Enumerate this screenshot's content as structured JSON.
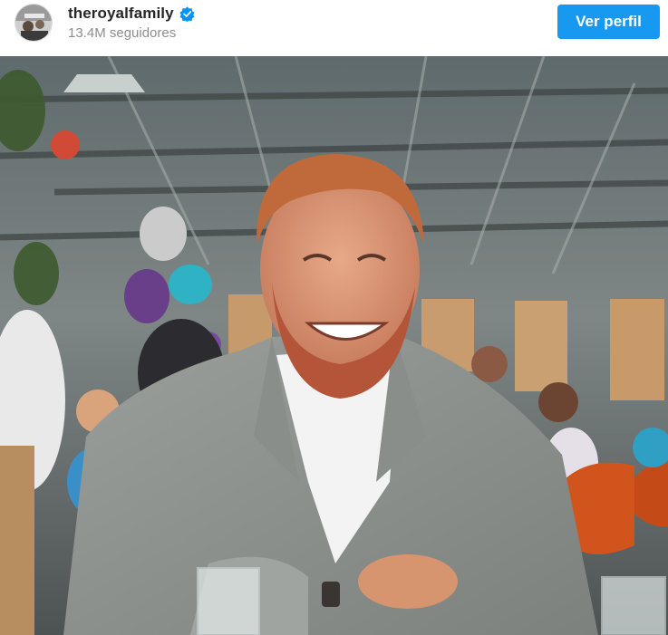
{
  "header": {
    "username": "theroyalfamily",
    "followers": "13.4M seguidores",
    "verified_icon": "verified-badge-icon",
    "profile_button_label": "Ver perfil"
  },
  "post": {
    "media_type": "photo"
  },
  "colors": {
    "accent": "#1798f1",
    "verified": "#0095f6",
    "username": "#262626",
    "muted": "#8e8e8e"
  }
}
